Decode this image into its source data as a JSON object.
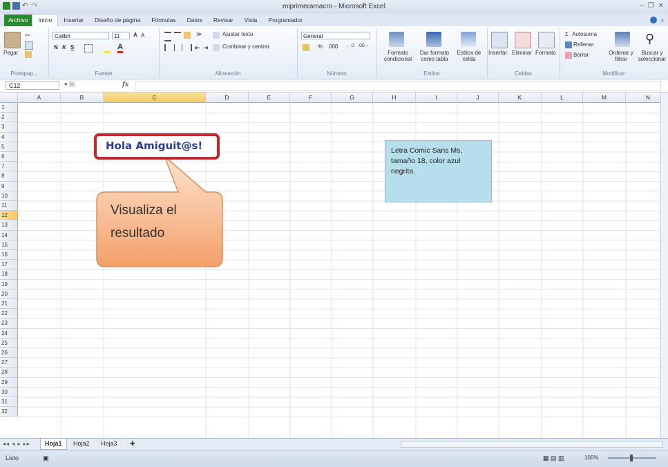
{
  "window": {
    "title": "miprimeramacro - Microsoft Excel"
  },
  "tabs": [
    "Archivo",
    "Inicio",
    "Insertar",
    "Diseño de página",
    "Fórmulas",
    "Datos",
    "Revisar",
    "Vista",
    "Programador"
  ],
  "ribbon": {
    "clipboard": {
      "paste": "Pegar",
      "group": "Portapap..."
    },
    "font": {
      "name": "Calibri",
      "size": "11",
      "bold": "N",
      "italic": "K",
      "underline": "S",
      "group": "Fuente"
    },
    "alignment": {
      "wrap": "Ajustar texto",
      "merge": "Combinar y centrar",
      "group": "Alineación"
    },
    "number": {
      "format": "General",
      "percent": "%",
      "thousands": "000",
      "group": "Número"
    },
    "styles": {
      "conditional": "Formato condicional",
      "table": "Dar formato como tabla",
      "cell": "Estilos de celda",
      "group": "Estilos"
    },
    "cells": {
      "insert": "Insertar",
      "delete": "Eliminar",
      "format": "Formato",
      "group": "Celdas"
    },
    "editing": {
      "autosum": "Autosuma",
      "fill": "Rellenar",
      "clear": "Borrar",
      "sort": "Ordenar y filtrar",
      "find": "Buscar y seleccionar",
      "group": "Modificar"
    }
  },
  "formula_bar": {
    "name_box": "C12",
    "fx": "fx",
    "content": ""
  },
  "columns": [
    "A",
    "B",
    "C",
    "D",
    "E",
    "F",
    "G",
    "H",
    "I",
    "J",
    "K",
    "L",
    "M",
    "N"
  ],
  "selected_column": "C",
  "rows": [
    "1",
    "2",
    "3",
    "4",
    "5",
    "6",
    "7",
    "8",
    "9",
    "10",
    "11",
    "12",
    "13",
    "14",
    "15",
    "16",
    "17",
    "18",
    "19",
    "20",
    "21",
    "22",
    "23",
    "24",
    "25",
    "26",
    "27",
    "28",
    "29",
    "30",
    "31",
    "32"
  ],
  "selected_row": "12",
  "cell_c4": "Hola Amiguit@s!",
  "callout": {
    "line1": "Visualiza el",
    "line2": "resultado"
  },
  "note": "Letra Comic Sans Ms, tamaño 18, color azul negrita.",
  "sheets": [
    "Hoja1",
    "Hoja2",
    "Hoja3"
  ],
  "active_sheet": "Hoja1",
  "status": {
    "mode": "Listo",
    "zoom": "100%"
  },
  "colors": {
    "highlight_border": "#c8262c",
    "text_blue": "#2a3b9a",
    "note_bg": "#b7dfeb",
    "callout_fill": "#f7b98a",
    "file_tab": "#2a8a2e"
  }
}
